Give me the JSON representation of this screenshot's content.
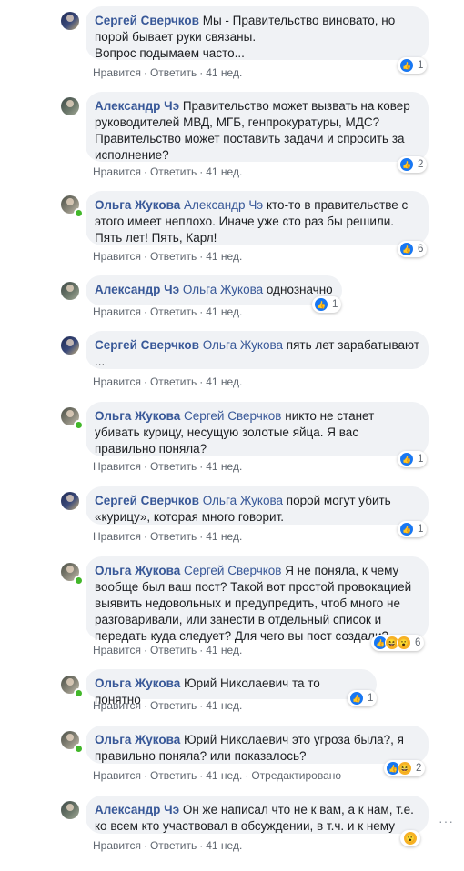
{
  "actions": {
    "like": "Нравится",
    "reply": "Ответить",
    "sep": "·",
    "edited": "Отредактировано"
  },
  "comments": [
    {
      "author": "Сергей Сверчков",
      "mention": "",
      "text_lines": [
        "Мы - Правительство виновато, но",
        "порой бывает руки связаны.",
        "Вопрос подымаем часто..."
      ],
      "time": "41 нед.",
      "reactions": [
        "like"
      ],
      "count": "1"
    },
    {
      "author": "Александр Чэ",
      "mention": "",
      "text_lines": [
        "Правительство может вызвать на ковер",
        "руководителей МВД, МГБ, генпрокуратуры, МДС?",
        "Правительство может поставить задачи и спросить за",
        "исполнение?"
      ],
      "time": "41 нед.",
      "reactions": [
        "like"
      ],
      "count": "2"
    },
    {
      "author": "Ольга Жукова",
      "mention": "Александр Чэ",
      "text_lines": [
        "кто-то в правительстве с",
        "этого имеет неплохо. Иначе уже сто раз бы решили.",
        "Пять лет! Пять, Карл!"
      ],
      "time": "41 нед.",
      "reactions": [
        "like"
      ],
      "count": "6"
    },
    {
      "author": "Александр Чэ",
      "mention": "Ольга Жукова",
      "text_lines": [
        "однозначно"
      ],
      "time": "41 нед.",
      "reactions": [
        "like"
      ],
      "count": "1"
    },
    {
      "author": "Сергей Сверчков",
      "mention": "Ольга Жукова",
      "text_lines": [
        "пять лет зарабатывают",
        "..."
      ],
      "time": "41 нед.",
      "reactions": [],
      "count": ""
    },
    {
      "author": "Ольга Жукова",
      "mention": "Сергей Сверчков",
      "text_lines": [
        "никто не станет",
        "убивать курицу, несущую золотые яйца. Я вас",
        "правильно поняла?"
      ],
      "time": "41 нед.",
      "reactions": [
        "like"
      ],
      "count": "1"
    },
    {
      "author": "Сергей Сверчков",
      "mention": "Ольга Жукова",
      "text_lines": [
        "порой могут убить",
        "«курицу», которая много говорит."
      ],
      "time": "41 нед.",
      "reactions": [
        "like"
      ],
      "count": "1"
    },
    {
      "author": "Ольга Жукова",
      "mention": "Сергей Сверчков",
      "text_lines": [
        "Я не поняла, к чему",
        "вообще был ваш пост? Такой вот простой провокацией",
        "выявить недовольных и предупредить, чтоб много не",
        "разговаривали, или занести в отдельный список и",
        "передать куда следует? Для чего вы пост создали?"
      ],
      "time": "41 нед.",
      "reactions": [
        "like",
        "haha",
        "wow"
      ],
      "count": "6"
    },
    {
      "author": "Ольга Жукова",
      "mention": "",
      "text_lines": [
        "Юрий Николаевич та то понятно"
      ],
      "time": "41 нед.",
      "reactions": [
        "like"
      ],
      "count": "1"
    },
    {
      "author": "Ольга Жукова",
      "mention": "",
      "text_lines": [
        "Юрий Николаевич это угроза была?, я",
        "правильно поняла? или показалось?"
      ],
      "time": "41 нед.",
      "edited": true,
      "reactions": [
        "like",
        "haha"
      ],
      "count": "2"
    },
    {
      "author": "Александр Чэ",
      "mention": "",
      "text_lines": [
        "Он же написал что не к вам, а к нам, т.е.",
        "ко всем кто участвовал в обсуждении, в т.ч. и к нему"
      ],
      "time": "41 нед.",
      "reactions": [
        "wow"
      ],
      "count": ""
    }
  ],
  "icons": {
    "like": "like-icon",
    "haha": "haha-icon",
    "wow": "wow-icon",
    "more": "more-options-icon"
  },
  "colors": {
    "link": "#385898",
    "bubble": "#f0f2f5",
    "like": "#1877f2",
    "online": "#42b72a"
  }
}
